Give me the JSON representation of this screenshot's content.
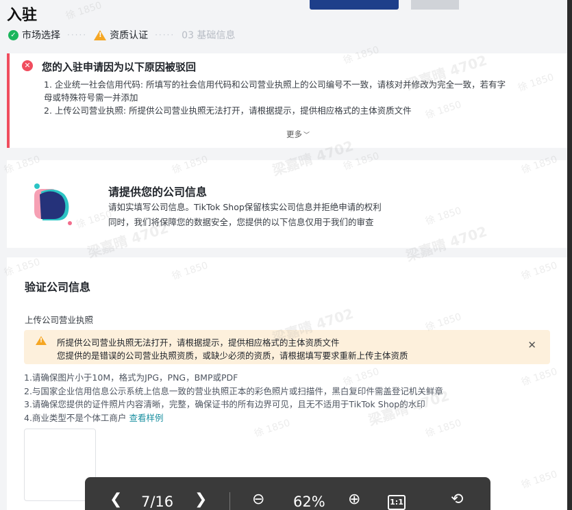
{
  "header": {
    "title": "入驻"
  },
  "steps": [
    {
      "label": "市场选择",
      "state": "done"
    },
    {
      "label": "资质认证",
      "state": "warning"
    },
    {
      "label": "03 基础信息",
      "state": "inactive"
    }
  ],
  "step_separator": "·····",
  "rejection": {
    "title": "您的入驻申请因为以下原因被驳回",
    "items": [
      "1. 企业统一社会信用代码: 所填写的社会信用代码和公司营业执照上的公司编号不一致，请核对并修改为完全一致，若有字",
      "母或特殊符号需一并添加",
      "2. 上传公司营业执照: 所提供公司营业执照无法打开，请根据提示，提供相应格式的主体资质文件"
    ],
    "more_label": "更多"
  },
  "company_info": {
    "title": "请提供您的公司信息",
    "line1": "请如实填写公司信息。TikTok Shop保留核实公司信息并拒绝申请的权利",
    "line2": "同时，我们将保障您的数据安全，您提供的以下信息仅用于我们的审查"
  },
  "verify": {
    "title": "验证公司信息",
    "upload_label": "上传公司营业执照",
    "warning": {
      "line1": "所提供公司营业执照无法打开，请根据提示，提供相应格式的主体资质文件",
      "line2": "您提供的是错误的公司营业执照资质，或缺少必须的资质，请根据填写要求重新上传主体资质"
    },
    "requirements": [
      "1.请确保图片小于10M，格式为JPG，PNG，BMP或PDF",
      "2.与国家企业信用信息公示系统上信息一致的营业执照正本的彩色照片或扫描件，黑白复印件需盖登记机关鲜章",
      "3.请确保您提供的证件照片内容清晰，完整，确保证书的所有边界可见，且无不适用于TikTok Shop的水印",
      "4.商业类型不是个体工商户"
    ],
    "sample_link": "查看样例"
  },
  "viewer": {
    "page": "7/16",
    "zoom": "62%",
    "fit_label": "1:1"
  },
  "watermarks": {
    "small": "徐 1850",
    "large": "梁嘉晴 4702"
  },
  "colors": {
    "accent": "#1a8fa0",
    "error": "#f04d5e",
    "warning": "#f5a623",
    "success": "#1bb55c",
    "warning_bg": "#fdf0dc"
  }
}
